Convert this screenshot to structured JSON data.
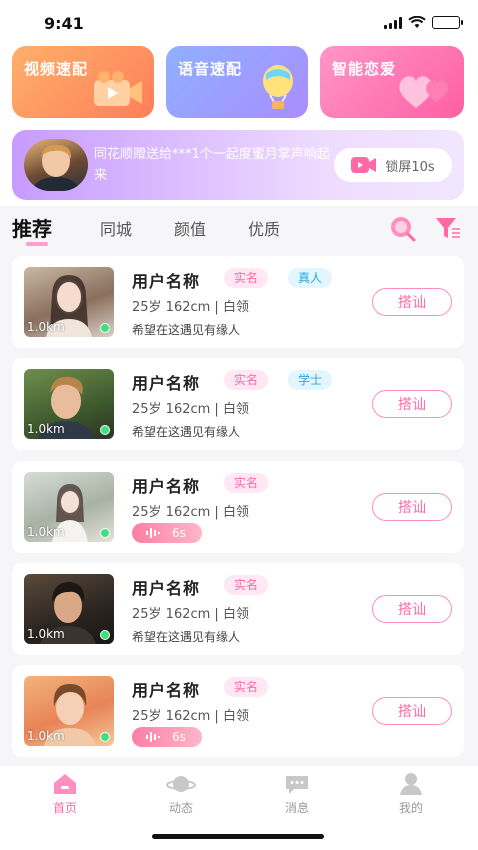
{
  "status": {
    "time": "9:41"
  },
  "quick_cards": [
    {
      "title": "视频速配",
      "icon": "video-camera-icon"
    },
    {
      "title": "语音速配",
      "icon": "hot-air-balloon-icon"
    },
    {
      "title": "智能恋爱",
      "icon": "hearts-icon"
    }
  ],
  "banner": {
    "text": "同花顺赠送给***1个一起度蜜月掌声响起来",
    "lock_label": "锁屏10s"
  },
  "tabs": [
    "推荐",
    "同城",
    "颜值",
    "优质"
  ],
  "users": [
    {
      "name": "用户名称",
      "verified": "实名",
      "extra_tag": "真人",
      "info": "25岁 162cm | 白领",
      "motto": "希望在这遇见有缘人",
      "voice": null,
      "distance": "1.0km",
      "button": "搭讪"
    },
    {
      "name": "用户名称",
      "verified": "实名",
      "extra_tag": "学士",
      "info": "25岁 162cm | 白领",
      "motto": "希望在这遇见有缘人",
      "voice": null,
      "distance": "1.0km",
      "button": "搭讪"
    },
    {
      "name": "用户名称",
      "verified": "实名",
      "extra_tag": null,
      "info": "25岁 162cm | 白领",
      "motto": null,
      "voice": "6s",
      "distance": "1.0km",
      "button": "搭讪"
    },
    {
      "name": "用户名称",
      "verified": "实名",
      "extra_tag": null,
      "info": "25岁 162cm | 白领",
      "motto": "希望在这遇见有缘人",
      "voice": null,
      "distance": "1.0km",
      "button": "搭讪"
    },
    {
      "name": "用户名称",
      "verified": "实名",
      "extra_tag": null,
      "info": "25岁 162cm | 白领",
      "motto": null,
      "voice": "6s",
      "distance": "1.0km",
      "button": "搭讪"
    }
  ],
  "tabbar": [
    {
      "label": "首页",
      "icon": "home-icon",
      "active": true
    },
    {
      "label": "动态",
      "icon": "planet-icon",
      "active": false
    },
    {
      "label": "消息",
      "icon": "message-icon",
      "active": false
    },
    {
      "label": "我的",
      "icon": "profile-icon",
      "active": false
    }
  ],
  "colors": {
    "accent": "#ff6aa6",
    "online": "#3ee07b",
    "tag_verified_bg": "#ffe8f3",
    "tag_extra_bg": "#e3f6ff"
  }
}
